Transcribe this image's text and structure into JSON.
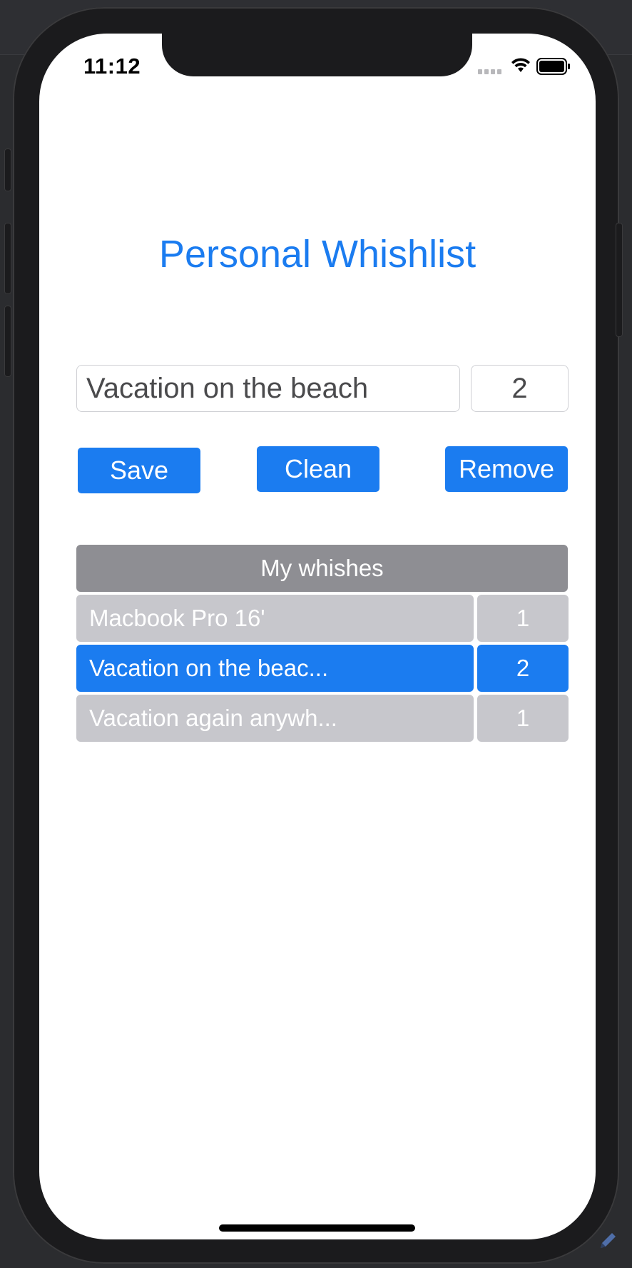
{
  "status_bar": {
    "time": "11:12"
  },
  "app": {
    "title": "Personal Whishlist"
  },
  "form": {
    "name_value": "Vacation on the beach",
    "quantity_value": "2"
  },
  "buttons": {
    "save_label": "Save",
    "clean_label": "Clean",
    "remove_label": "Remove"
  },
  "table": {
    "header": "My whishes",
    "rows": [
      {
        "name": "Macbook Pro 16'",
        "quantity": "1",
        "selected": false
      },
      {
        "name": "Vacation on the beac...",
        "quantity": "2",
        "selected": true
      },
      {
        "name": "Vacation again anywh...",
        "quantity": "1",
        "selected": false
      }
    ]
  },
  "colors": {
    "accent": "#1b7cf0",
    "header_gray": "#8e8e93",
    "row_gray": "#c7c7cc"
  },
  "icons": [
    "signal-icon",
    "wifi-icon",
    "battery-icon",
    "pencil-icon"
  ]
}
